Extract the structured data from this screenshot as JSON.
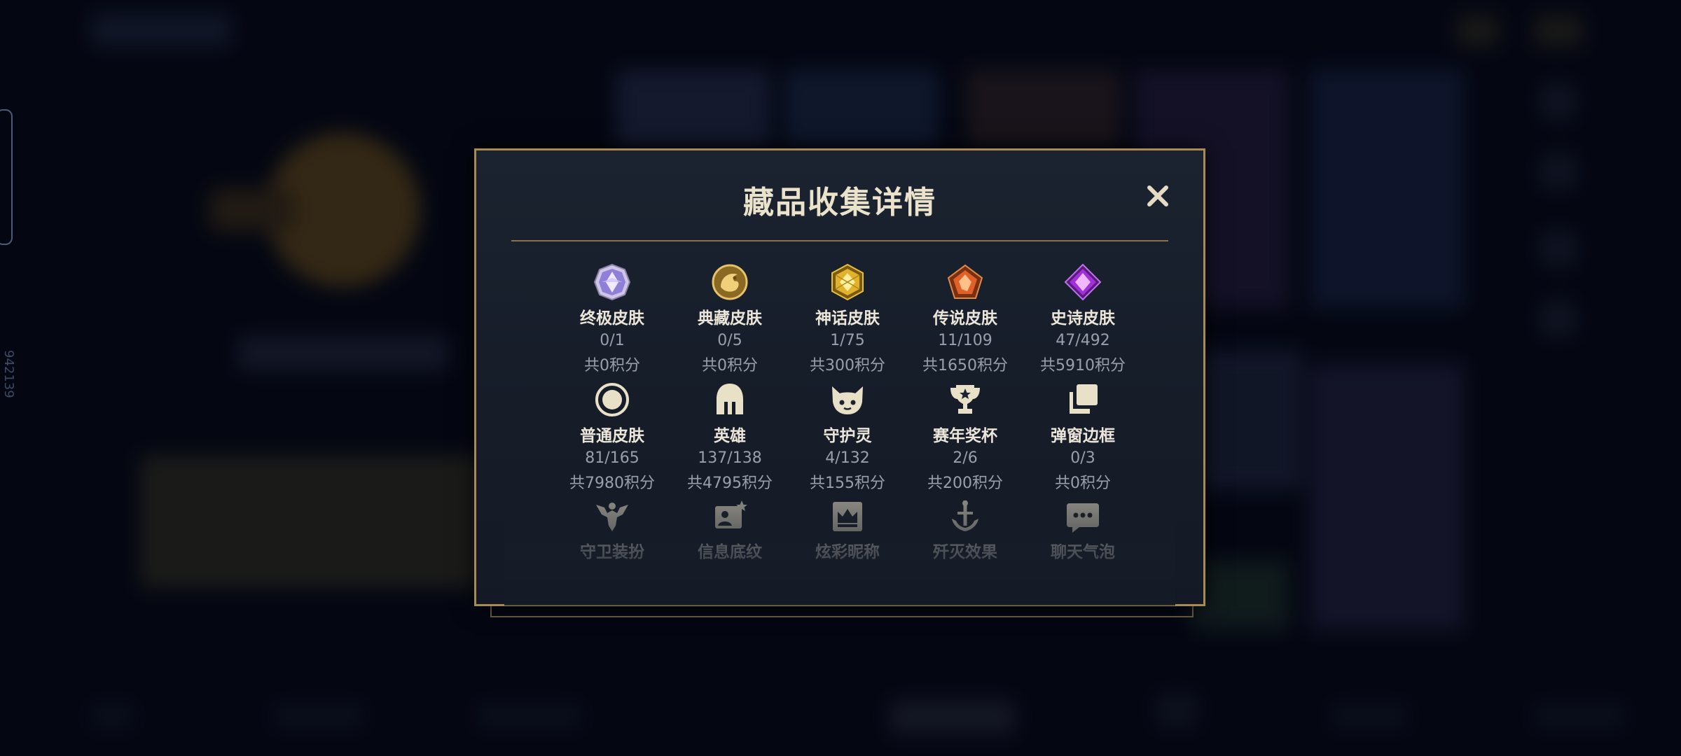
{
  "modal": {
    "title": "藏品收集详情",
    "items": [
      {
        "label": "终极皮肤",
        "count": "0/1",
        "points": "共0积分",
        "icon": "ultimate-gem-icon"
      },
      {
        "label": "典藏皮肤",
        "count": "0/5",
        "points": "共0积分",
        "icon": "dragon-emblem-icon"
      },
      {
        "label": "神话皮肤",
        "count": "1/75",
        "points": "共300积分",
        "icon": "mythic-gem-icon"
      },
      {
        "label": "传说皮肤",
        "count": "11/109",
        "points": "共1650积分",
        "icon": "legendary-gem-icon"
      },
      {
        "label": "史诗皮肤",
        "count": "47/492",
        "points": "共5910积分",
        "icon": "epic-gem-icon"
      },
      {
        "label": "普通皮肤",
        "count": "81/165",
        "points": "共7980积分",
        "icon": "circle-icon"
      },
      {
        "label": "英雄",
        "count": "137/138",
        "points": "共4795积分",
        "icon": "helmet-icon"
      },
      {
        "label": "守护灵",
        "count": "4/132",
        "points": "共155积分",
        "icon": "guardian-face-icon"
      },
      {
        "label": "赛年奖杯",
        "count": "2/6",
        "points": "共200积分",
        "icon": "trophy-icon"
      },
      {
        "label": "弹窗边框",
        "count": "0/3",
        "points": "共0积分",
        "icon": "frame-stack-icon"
      },
      {
        "label": "守卫装扮",
        "icon": "ward-icon"
      },
      {
        "label": "信息底纹",
        "icon": "card-star-icon"
      },
      {
        "label": "炫彩昵称",
        "icon": "crown-tag-icon"
      },
      {
        "label": "歼灭效果",
        "icon": "sword-icon"
      },
      {
        "label": "聊天气泡",
        "icon": "chat-bubble-icon"
      }
    ]
  },
  "background": {
    "side_number": "942139"
  },
  "colors": {
    "accent_gold": "#a88b52",
    "title_text": "#ebe2cc",
    "muted_text": "#9aa0aa",
    "modal_bg": "#1b2330"
  }
}
